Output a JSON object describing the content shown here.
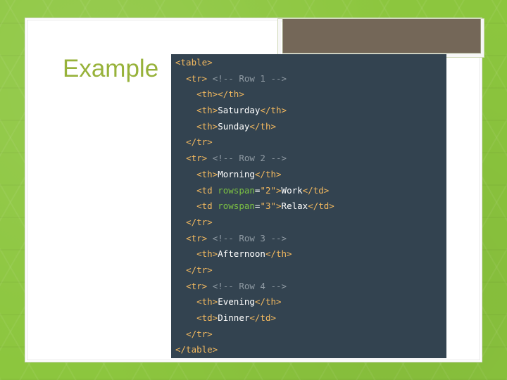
{
  "slide": {
    "title": "Example"
  },
  "code": {
    "lines": [
      {
        "indent": "",
        "segments": [
          {
            "t": "tag",
            "v": "<table>"
          }
        ]
      },
      {
        "indent": "  ",
        "segments": [
          {
            "t": "tag",
            "v": "<tr>"
          },
          {
            "t": "comment",
            "v": " <!-- Row 1 -->"
          }
        ]
      },
      {
        "indent": "    ",
        "segments": [
          {
            "t": "tag",
            "v": "<th></th>"
          }
        ]
      },
      {
        "indent": "    ",
        "segments": [
          {
            "t": "tag",
            "v": "<th>"
          },
          {
            "t": "txt",
            "v": "Saturday"
          },
          {
            "t": "tag",
            "v": "</th>"
          }
        ]
      },
      {
        "indent": "    ",
        "segments": [
          {
            "t": "tag",
            "v": "<th>"
          },
          {
            "t": "txt",
            "v": "Sunday"
          },
          {
            "t": "tag",
            "v": "</th>"
          }
        ]
      },
      {
        "indent": "  ",
        "segments": [
          {
            "t": "tag",
            "v": "</tr>"
          }
        ]
      },
      {
        "indent": "  ",
        "segments": [
          {
            "t": "tag",
            "v": "<tr>"
          },
          {
            "t": "comment",
            "v": " <!-- Row 2 -->"
          }
        ]
      },
      {
        "indent": "    ",
        "segments": [
          {
            "t": "tag",
            "v": "<th>"
          },
          {
            "t": "txt",
            "v": "Morning"
          },
          {
            "t": "tag",
            "v": "</th>"
          }
        ]
      },
      {
        "indent": "    ",
        "segments": [
          {
            "t": "tag",
            "v": "<td "
          },
          {
            "t": "attr",
            "v": "rowspan"
          },
          {
            "t": "txt",
            "v": "="
          },
          {
            "t": "str",
            "v": "\"2\""
          },
          {
            "t": "tag",
            "v": ">"
          },
          {
            "t": "txt",
            "v": "Work"
          },
          {
            "t": "tag",
            "v": "</td>"
          }
        ]
      },
      {
        "indent": "    ",
        "segments": [
          {
            "t": "tag",
            "v": "<td "
          },
          {
            "t": "attr",
            "v": "rowspan"
          },
          {
            "t": "txt",
            "v": "="
          },
          {
            "t": "str",
            "v": "\"3\""
          },
          {
            "t": "tag",
            "v": ">"
          },
          {
            "t": "txt",
            "v": "Relax"
          },
          {
            "t": "tag",
            "v": "</td>"
          }
        ]
      },
      {
        "indent": "  ",
        "segments": [
          {
            "t": "tag",
            "v": "</tr>"
          }
        ]
      },
      {
        "indent": "  ",
        "segments": [
          {
            "t": "tag",
            "v": "<tr>"
          },
          {
            "t": "comment",
            "v": " <!-- Row 3 -->"
          }
        ]
      },
      {
        "indent": "    ",
        "segments": [
          {
            "t": "tag",
            "v": "<th>"
          },
          {
            "t": "txt",
            "v": "Afternoon"
          },
          {
            "t": "tag",
            "v": "</th>"
          }
        ]
      },
      {
        "indent": "  ",
        "segments": [
          {
            "t": "tag",
            "v": "</tr>"
          }
        ]
      },
      {
        "indent": "  ",
        "segments": [
          {
            "t": "tag",
            "v": "<tr>"
          },
          {
            "t": "comment",
            "v": " <!-- Row 4 -->"
          }
        ]
      },
      {
        "indent": "    ",
        "segments": [
          {
            "t": "tag",
            "v": "<th>"
          },
          {
            "t": "txt",
            "v": "Evening"
          },
          {
            "t": "tag",
            "v": "</th>"
          }
        ]
      },
      {
        "indent": "    ",
        "segments": [
          {
            "t": "tag",
            "v": "<td>"
          },
          {
            "t": "txt",
            "v": "Dinner"
          },
          {
            "t": "tag",
            "v": "</td>"
          }
        ]
      },
      {
        "indent": "  ",
        "segments": [
          {
            "t": "tag",
            "v": "</tr>"
          }
        ]
      },
      {
        "indent": "",
        "segments": [
          {
            "t": "tag",
            "v": "</table>"
          }
        ]
      }
    ]
  },
  "colors": {
    "background_green": "#8cc63e",
    "title_green": "#97b23a",
    "code_background": "#334350",
    "tag_color": "#f3b95f",
    "comment_color": "#8f9aa3",
    "attribute_color": "#7bc043",
    "decor_tab": "#746758"
  }
}
